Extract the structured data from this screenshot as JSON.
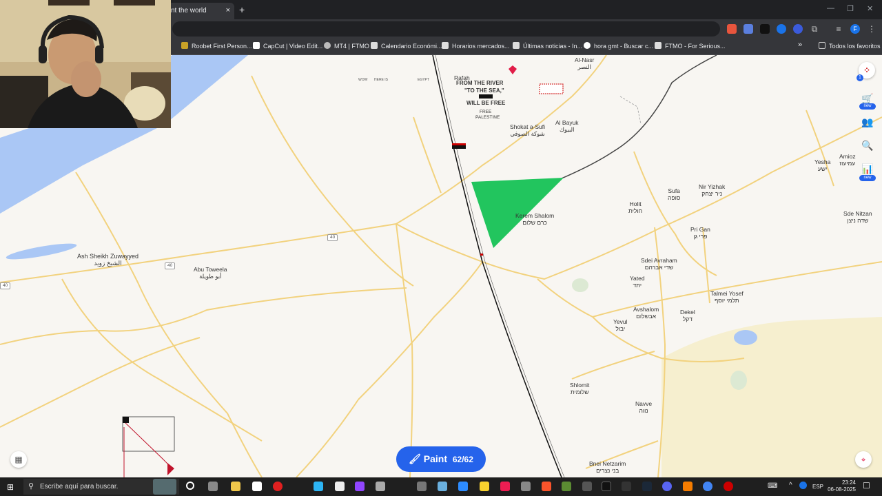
{
  "browser": {
    "tab_title": "nt the world",
    "tab_close": "×",
    "new_tab": "+",
    "window_controls": [
      "—",
      "❐",
      "✕"
    ],
    "bookmarks": [
      "Roobet First Person...",
      "CapCut | Video Edit...",
      "MT4 | FTMO",
      "Calendario Económi...",
      "Horarios mercados...",
      "Últimas noticias - In...",
      "hora gmt - Buscar c...",
      "FTMO - For Serious..."
    ],
    "bookmarks_more": "»",
    "all_bookmarks": "Todos los favoritos",
    "profile_initial": "F"
  },
  "map": {
    "places": [
      {
        "name": "Al-Nasr",
        "native": "النصر"
      },
      {
        "name": "Rafah",
        "native": ""
      },
      {
        "name": "Shokat a-Sufi",
        "native": "شوكة الصوفي"
      },
      {
        "name": "Al Bayuk",
        "native": "البيوك"
      },
      {
        "name": "Amioz",
        "native": "עמיעוז"
      },
      {
        "name": "Yesha",
        "native": "ישע"
      },
      {
        "name": "Sufa",
        "native": "סופה"
      },
      {
        "name": "Nir Yizhak",
        "native": "ניר יצחק"
      },
      {
        "name": "Holit",
        "native": "חולית"
      },
      {
        "name": "Kerem Shalom",
        "native": "כרם שלום"
      },
      {
        "name": "Pri Gan",
        "native": "פרי גן"
      },
      {
        "name": "Sde Nitzan",
        "native": "שדה ניצן"
      },
      {
        "name": "Ash Sheikh Zuwayyed",
        "native": "الشيخ زويد"
      },
      {
        "name": "Abu Toweela",
        "native": "أبو طويلة"
      },
      {
        "name": "Sdei Avraham",
        "native": "שדי אברהם"
      },
      {
        "name": "Yated",
        "native": "יתד"
      },
      {
        "name": "Talmei Yosef",
        "native": "תלמי יוסף"
      },
      {
        "name": "Avshalom",
        "native": "אבשלום"
      },
      {
        "name": "Dekel",
        "native": "דקל"
      },
      {
        "name": "Yevul",
        "native": "יבול"
      },
      {
        "name": "Shlomit",
        "native": "שלומית"
      },
      {
        "name": "Navve",
        "native": "נווה"
      },
      {
        "name": "Bnei Netzarim",
        "native": "בני נצרים"
      }
    ],
    "road_shields": [
      "40",
      "40",
      "40"
    ],
    "pixel_art_text": [
      "FROM THE RIVER",
      "\"TO THE SEA,\"",
      "WILL BE FREE",
      "FREE",
      "PALESTINE"
    ],
    "small_text": [
      "WOW",
      "HERE IS",
      "EGYPT"
    ],
    "side_tools": [
      {
        "icon": "cart-icon",
        "glyph": "🛒",
        "badge": "new"
      },
      {
        "icon": "users-icon",
        "glyph": "👥",
        "badge": ""
      },
      {
        "icon": "search-map-icon",
        "glyph": "🔍",
        "badge": ""
      },
      {
        "icon": "leaderboard-icon",
        "glyph": "📊",
        "badge": "new"
      }
    ],
    "notif_count": "1"
  },
  "paint": {
    "label": "Paint",
    "count": "62/62"
  },
  "taskbar": {
    "search_placeholder": "Escribe aquí para buscar.",
    "lang": "ESP",
    "time": "23:24",
    "date": "06-08-2025"
  },
  "colors": {
    "paint_blue": "#2563eb",
    "green_area": "#22c55e",
    "sea": "#aac7f5",
    "road": "#f2d27e"
  }
}
